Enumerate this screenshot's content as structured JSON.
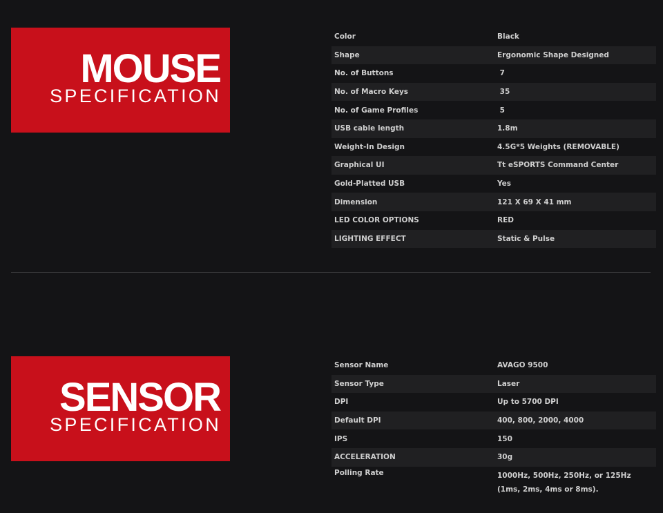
{
  "mouse": {
    "banner_title": "MOUSE",
    "banner_subtitle": "SPECIFICATION",
    "specs": [
      {
        "label": "Color",
        "value": "Black"
      },
      {
        "label": "Shape",
        "value": "Ergonomic Shape Designed"
      },
      {
        "label": "No. of Buttons",
        "value": " 7"
      },
      {
        "label": "No. of Macro Keys",
        "value": " 35"
      },
      {
        "label": "No. of Game Profiles",
        "value": " 5"
      },
      {
        "label": "USB cable length",
        "value": "1.8m"
      },
      {
        "label": "Weight-In Design",
        "value": "4.5G*5 Weights (REMOVABLE)"
      },
      {
        "label": "Graphical UI",
        "value": "Tt eSPORTS Command Center"
      },
      {
        "label": "Gold-Platted USB",
        "value": "Yes"
      },
      {
        "label": "Dimension",
        "value": "121 X 69 X 41 mm"
      },
      {
        "label": "LED COLOR OPTIONS",
        "value": "RED"
      },
      {
        "label": "LIGHTING EFFECT",
        "value": "Static & Pulse"
      }
    ]
  },
  "sensor": {
    "banner_title": "SENSOR",
    "banner_subtitle": "SPECIFICATION",
    "specs": [
      {
        "label": "Sensor Name",
        "value": "AVAGO 9500"
      },
      {
        "label": "Sensor Type",
        "value": "Laser"
      },
      {
        "label": "DPI",
        "value": "Up to 5700 DPI"
      },
      {
        "label": "Default DPI",
        "value": "400, 800, 2000, 4000"
      },
      {
        "label": "IPS",
        "value": "150"
      },
      {
        "label": "ACCELERATION",
        "value": "30g"
      },
      {
        "label": "Polling Rate",
        "value": "1000Hz, 500Hz, 250Hz, or 125Hz (1ms, 2ms, 4ms or 8ms)."
      }
    ]
  },
  "colors": {
    "background": "#141416",
    "banner_red": "#c8101b",
    "row_alt": "#202022",
    "text": "#cfcfcf"
  }
}
